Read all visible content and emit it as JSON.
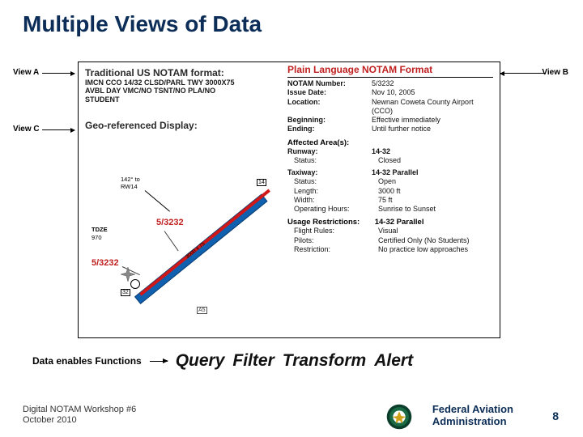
{
  "title": "Multiple Views of Data",
  "labels": {
    "view_a": "View A",
    "view_b": "View B",
    "view_c": "View C"
  },
  "viewA": {
    "heading": "Traditional US NOTAM format:",
    "text1": "IMCN CCO 14/32 CLSD/PARL TWY 3000X75",
    "text2": "AVBL DAY VMC/NO TSNT/NO PLA/NO",
    "text3": "STUDENT"
  },
  "viewB": {
    "heading": "Plain Language NOTAM Format",
    "rows": {
      "notam_number_l": "NOTAM Number:",
      "notam_number_v": "5/3232",
      "issue_date_l": "Issue Date:",
      "issue_date_v": "Nov 10, 2005",
      "location_l": "Location:",
      "location_v1": "Newnan Coweta County Airport",
      "location_v2": "(CCO)",
      "beginning_l": "Beginning:",
      "beginning_v": "Effective immediately",
      "ending_l": "Ending:",
      "ending_v": "Until further notice",
      "affected_hdr": "Affected Area(s):",
      "runway_l": "Runway:",
      "runway_v": "14-32",
      "status1_l": "Status:",
      "status1_v": "Closed",
      "taxiway_l": "Taxiway:",
      "taxiway_v": "14-32 Parallel",
      "status2_l": "Status:",
      "status2_v": "Open",
      "length_l": "Length:",
      "length_v": "3000 ft",
      "width_l": "Width:",
      "width_v": "75 ft",
      "ophours_l": "Operating Hours:",
      "ophours_v": "Sunrise to Sunset",
      "usage_hdr": "Usage Restrictions:",
      "usage_v": "14-32 Parallel",
      "flight_l": "Flight Rules:",
      "flight_v": "Visual",
      "pilots_l": "Pilots:",
      "pilots_v": "Certified Only (No Students)",
      "restriction_l": "Restriction:",
      "restriction_v": "No practice low approaches"
    }
  },
  "viewC": {
    "heading": "Geo-referenced Display:",
    "callout1": "142° to",
    "callout2": "RW14",
    "tdze_l": "TDZE",
    "tdze_v": "970",
    "ref1": "5/3232",
    "ref2": "5/3232",
    "a5": "A5",
    "dim_text": "3000 x 75"
  },
  "functions": {
    "lead": "Data enables Functions",
    "q": "Query",
    "f": "Filter",
    "t": "Transform",
    "a": "Alert"
  },
  "footer": {
    "line1": "Digital NOTAM Workshop #6",
    "line2": "October 2010",
    "org1": "Federal Aviation",
    "org2": "Administration",
    "page": "8"
  }
}
